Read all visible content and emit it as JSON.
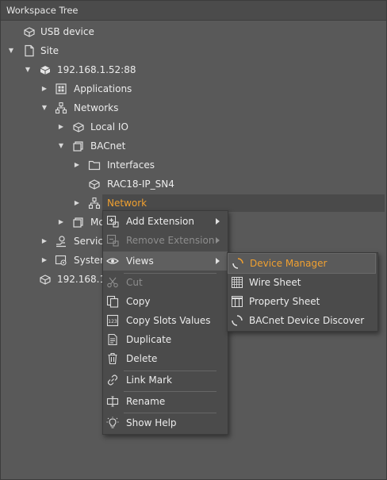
{
  "panel": {
    "title": "Workspace Tree"
  },
  "tree": {
    "usb_device": "USB device",
    "site": "Site",
    "ip_device": "192.168.1.52:88",
    "applications": "Applications",
    "networks": "Networks",
    "local_io": "Local IO",
    "bacnet": "BACnet",
    "interfaces": "Interfaces",
    "rac18": "RAC18-IP_SN4",
    "network": "Network",
    "modbus_partial": "Mo",
    "services_partial": "Service",
    "system_partial": "System",
    "ip_device2_partial": "192.168.1."
  },
  "context_menu": {
    "add_extension": "Add Extension",
    "remove_extension": "Remove Extension",
    "views": "Views",
    "cut": "Cut",
    "copy": "Copy",
    "copy_slots_values": "Copy Slots Values",
    "duplicate": "Duplicate",
    "delete": "Delete",
    "link_mark": "Link Mark",
    "rename": "Rename",
    "show_help": "Show Help"
  },
  "views_submenu": {
    "device_manager": "Device Manager",
    "wire_sheet": "Wire Sheet",
    "property_sheet": "Property Sheet",
    "bacnet_device_discover": "BACnet Device Discover"
  },
  "colors": {
    "background": "#595959",
    "menu_background": "#4b4b4b",
    "accent": "#f0a030"
  }
}
